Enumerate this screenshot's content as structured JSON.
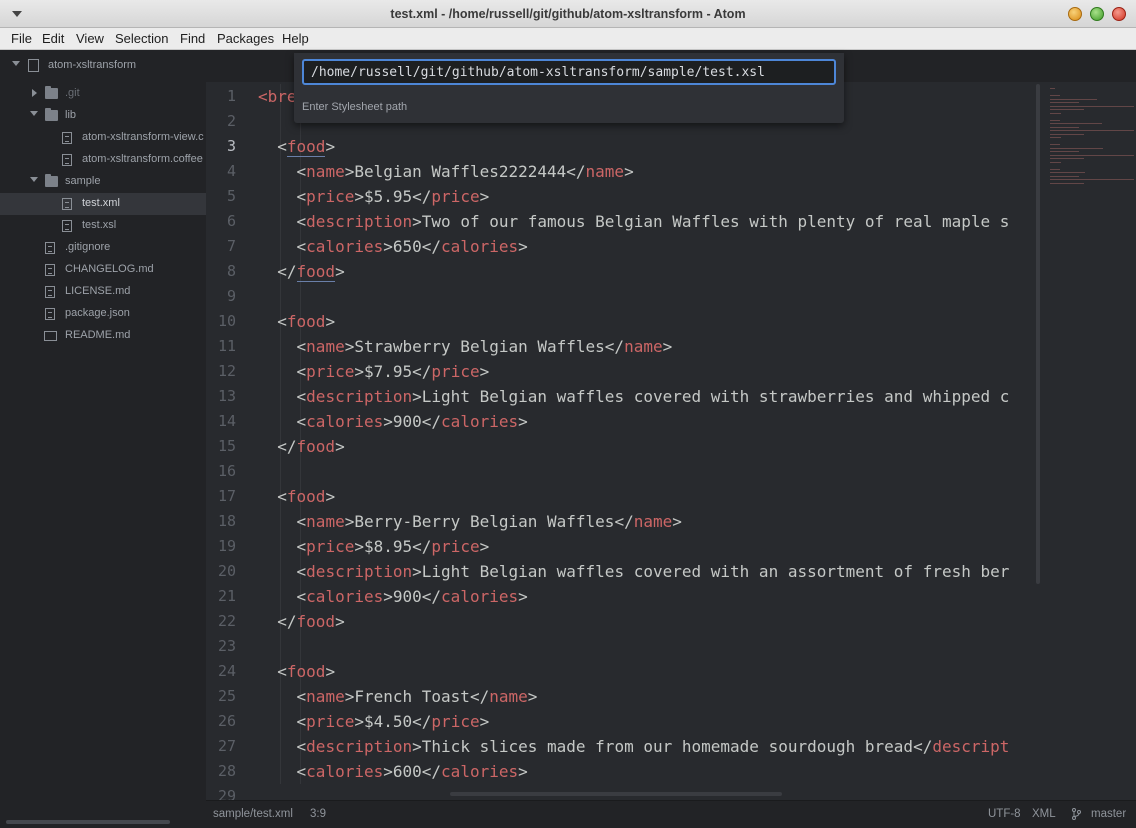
{
  "window": {
    "title": "test.xml - /home/russell/git/github/atom-xsltransform - Atom"
  },
  "menu": [
    "File",
    "Edit",
    "View",
    "Selection",
    "Find",
    "Packages",
    "Help"
  ],
  "tree": {
    "project": "atom-xsltransform",
    "items": [
      {
        "label": ".git",
        "kind": "folder",
        "state": "collapsed"
      },
      {
        "label": "lib",
        "kind": "folder",
        "state": "expanded"
      },
      {
        "label": "atom-xsltransform-view.c",
        "kind": "file"
      },
      {
        "label": "atom-xsltransform.coffee",
        "kind": "file"
      },
      {
        "label": "sample",
        "kind": "folder",
        "state": "expanded"
      },
      {
        "label": "test.xml",
        "kind": "file",
        "selected": true
      },
      {
        "label": "test.xsl",
        "kind": "file"
      },
      {
        "label": ".gitignore",
        "kind": "file"
      },
      {
        "label": "CHANGELOG.md",
        "kind": "file"
      },
      {
        "label": "LICENSE.md",
        "kind": "file"
      },
      {
        "label": "package.json",
        "kind": "file"
      },
      {
        "label": "README.md",
        "kind": "book"
      }
    ]
  },
  "palette": {
    "value": "/home/russell/git/github/atom-xsltransform/sample/test.xsl",
    "hint": "Enter Stylesheet path"
  },
  "editor": {
    "current_line": 3,
    "lines": [
      {
        "n": "1",
        "parts": [
          [
            "tag",
            "<bre"
          ]
        ]
      },
      {
        "n": "2",
        "parts": []
      },
      {
        "n": "3",
        "parts": [
          [
            "p",
            "  <"
          ],
          [
            "taghl",
            "food"
          ],
          [
            "p",
            ">"
          ]
        ]
      },
      {
        "n": "4",
        "parts": [
          [
            "p",
            "    <"
          ],
          [
            "tag",
            "name"
          ],
          [
            "p",
            ">"
          ],
          [
            "txt",
            "Belgian Waffles2222444"
          ],
          [
            "p",
            "</"
          ],
          [
            "tag",
            "name"
          ],
          [
            "p",
            ">"
          ]
        ]
      },
      {
        "n": "5",
        "parts": [
          [
            "p",
            "    <"
          ],
          [
            "tag",
            "price"
          ],
          [
            "p",
            ">"
          ],
          [
            "txt",
            "$5.95"
          ],
          [
            "p",
            "</"
          ],
          [
            "tag",
            "price"
          ],
          [
            "p",
            ">"
          ]
        ]
      },
      {
        "n": "6",
        "parts": [
          [
            "p",
            "    <"
          ],
          [
            "tag",
            "description"
          ],
          [
            "p",
            ">"
          ],
          [
            "txt",
            "Two of our famous Belgian Waffles with plenty of real maple s"
          ]
        ]
      },
      {
        "n": "7",
        "parts": [
          [
            "p",
            "    <"
          ],
          [
            "tag",
            "calories"
          ],
          [
            "p",
            ">"
          ],
          [
            "txt",
            "650"
          ],
          [
            "p",
            "</"
          ],
          [
            "tag",
            "calories"
          ],
          [
            "p",
            ">"
          ]
        ]
      },
      {
        "n": "8",
        "parts": [
          [
            "p",
            "  </"
          ],
          [
            "taghl",
            "food"
          ],
          [
            "p",
            ">"
          ]
        ]
      },
      {
        "n": "9",
        "parts": []
      },
      {
        "n": "10",
        "parts": [
          [
            "p",
            "  <"
          ],
          [
            "tag",
            "food"
          ],
          [
            "p",
            ">"
          ]
        ]
      },
      {
        "n": "11",
        "parts": [
          [
            "p",
            "    <"
          ],
          [
            "tag",
            "name"
          ],
          [
            "p",
            ">"
          ],
          [
            "txt",
            "Strawberry Belgian Waffles"
          ],
          [
            "p",
            "</"
          ],
          [
            "tag",
            "name"
          ],
          [
            "p",
            ">"
          ]
        ]
      },
      {
        "n": "12",
        "parts": [
          [
            "p",
            "    <"
          ],
          [
            "tag",
            "price"
          ],
          [
            "p",
            ">"
          ],
          [
            "txt",
            "$7.95"
          ],
          [
            "p",
            "</"
          ],
          [
            "tag",
            "price"
          ],
          [
            "p",
            ">"
          ]
        ]
      },
      {
        "n": "13",
        "parts": [
          [
            "p",
            "    <"
          ],
          [
            "tag",
            "description"
          ],
          [
            "p",
            ">"
          ],
          [
            "txt",
            "Light Belgian waffles covered with strawberries and whipped c"
          ]
        ]
      },
      {
        "n": "14",
        "parts": [
          [
            "p",
            "    <"
          ],
          [
            "tag",
            "calories"
          ],
          [
            "p",
            ">"
          ],
          [
            "txt",
            "900"
          ],
          [
            "p",
            "</"
          ],
          [
            "tag",
            "calories"
          ],
          [
            "p",
            ">"
          ]
        ]
      },
      {
        "n": "15",
        "parts": [
          [
            "p",
            "  </"
          ],
          [
            "tag",
            "food"
          ],
          [
            "p",
            ">"
          ]
        ]
      },
      {
        "n": "16",
        "parts": []
      },
      {
        "n": "17",
        "parts": [
          [
            "p",
            "  <"
          ],
          [
            "tag",
            "food"
          ],
          [
            "p",
            ">"
          ]
        ]
      },
      {
        "n": "18",
        "parts": [
          [
            "p",
            "    <"
          ],
          [
            "tag",
            "name"
          ],
          [
            "p",
            ">"
          ],
          [
            "txt",
            "Berry-Berry Belgian Waffles"
          ],
          [
            "p",
            "</"
          ],
          [
            "tag",
            "name"
          ],
          [
            "p",
            ">"
          ]
        ]
      },
      {
        "n": "19",
        "parts": [
          [
            "p",
            "    <"
          ],
          [
            "tag",
            "price"
          ],
          [
            "p",
            ">"
          ],
          [
            "txt",
            "$8.95"
          ],
          [
            "p",
            "</"
          ],
          [
            "tag",
            "price"
          ],
          [
            "p",
            ">"
          ]
        ]
      },
      {
        "n": "20",
        "parts": [
          [
            "p",
            "    <"
          ],
          [
            "tag",
            "description"
          ],
          [
            "p",
            ">"
          ],
          [
            "txt",
            "Light Belgian waffles covered with an assortment of fresh ber"
          ]
        ]
      },
      {
        "n": "21",
        "parts": [
          [
            "p",
            "    <"
          ],
          [
            "tag",
            "calories"
          ],
          [
            "p",
            ">"
          ],
          [
            "txt",
            "900"
          ],
          [
            "p",
            "</"
          ],
          [
            "tag",
            "calories"
          ],
          [
            "p",
            ">"
          ]
        ]
      },
      {
        "n": "22",
        "parts": [
          [
            "p",
            "  </"
          ],
          [
            "tag",
            "food"
          ],
          [
            "p",
            ">"
          ]
        ]
      },
      {
        "n": "23",
        "parts": []
      },
      {
        "n": "24",
        "parts": [
          [
            "p",
            "  <"
          ],
          [
            "tag",
            "food"
          ],
          [
            "p",
            ">"
          ]
        ]
      },
      {
        "n": "25",
        "parts": [
          [
            "p",
            "    <"
          ],
          [
            "tag",
            "name"
          ],
          [
            "p",
            ">"
          ],
          [
            "txt",
            "French Toast"
          ],
          [
            "p",
            "</"
          ],
          [
            "tag",
            "name"
          ],
          [
            "p",
            ">"
          ]
        ]
      },
      {
        "n": "26",
        "parts": [
          [
            "p",
            "    <"
          ],
          [
            "tag",
            "price"
          ],
          [
            "p",
            ">"
          ],
          [
            "txt",
            "$4.50"
          ],
          [
            "p",
            "</"
          ],
          [
            "tag",
            "price"
          ],
          [
            "p",
            ">"
          ]
        ]
      },
      {
        "n": "27",
        "parts": [
          [
            "p",
            "    <"
          ],
          [
            "tag",
            "description"
          ],
          [
            "p",
            ">"
          ],
          [
            "txt",
            "Thick slices made from our homemade sourdough bread"
          ],
          [
            "p",
            "</"
          ],
          [
            "tag",
            "descript"
          ]
        ]
      },
      {
        "n": "28",
        "parts": [
          [
            "p",
            "    <"
          ],
          [
            "tag",
            "calories"
          ],
          [
            "p",
            ">"
          ],
          [
            "txt",
            "600"
          ],
          [
            "p",
            "</"
          ],
          [
            "tag",
            "calories"
          ],
          [
            "p",
            ">"
          ]
        ]
      },
      {
        "n": "29",
        "parts": []
      }
    ]
  },
  "status": {
    "file": "sample/test.xml",
    "cursor": "3:9",
    "encoding": "UTF-8",
    "grammar": "XML",
    "branch": "master"
  },
  "colors": {
    "tag": "#cc6666",
    "accent": "#4d86d7",
    "background": "#282a2e"
  }
}
